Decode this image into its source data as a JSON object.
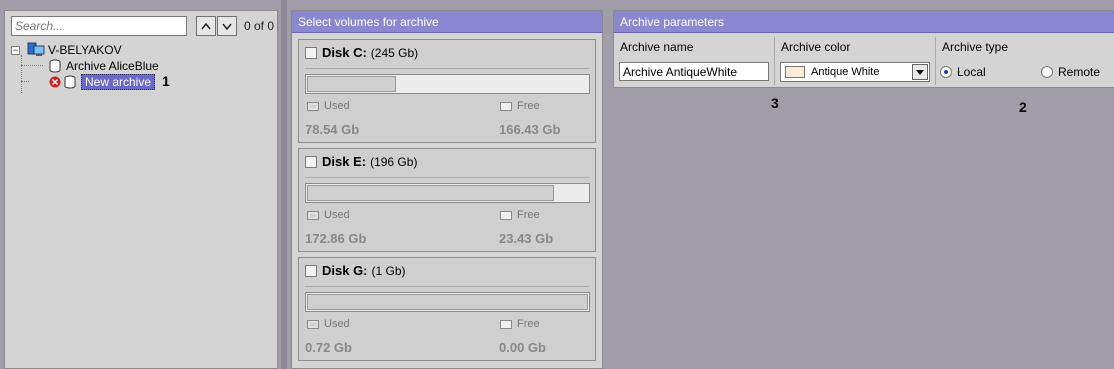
{
  "search": {
    "placeholder": "Search...",
    "count": "0 of 0"
  },
  "tree": {
    "root": "V-BELYAKOV",
    "items": [
      {
        "label": "Archive AliceBlue"
      },
      {
        "label": "New archive",
        "selected": true
      }
    ]
  },
  "annotations": {
    "a1": "1",
    "a2": "2",
    "a3": "3"
  },
  "volumes": {
    "header": "Select volumes for archive",
    "used_label": "Used",
    "free_label": "Free",
    "disks": [
      {
        "name": "Disk C:",
        "size": "(245 Gb)",
        "used": "78.54 Gb",
        "free": "166.43 Gb",
        "used_fraction": 0.32
      },
      {
        "name": "Disk E:",
        "size": "(196 Gb)",
        "used": "172.86 Gb",
        "free": "23.43 Gb",
        "used_fraction": 0.88
      },
      {
        "name": "Disk G:",
        "size": "(1 Gb)",
        "used": "0.72 Gb",
        "free": "0.00 Gb",
        "used_fraction": 1.0
      }
    ]
  },
  "params": {
    "header": "Archive parameters",
    "name_label": "Archive name",
    "name_value": "Archive AntiqueWhite",
    "color_label": "Archive color",
    "color_value": "Antique White",
    "color_hex": "#faebd7",
    "type_label": "Archive type",
    "type_local": "Local",
    "type_remote": "Remote",
    "type_selected": "Local"
  },
  "colors": {
    "header": "#8b87d1",
    "selection": "#6a68c8",
    "background": "#a09ca8"
  }
}
